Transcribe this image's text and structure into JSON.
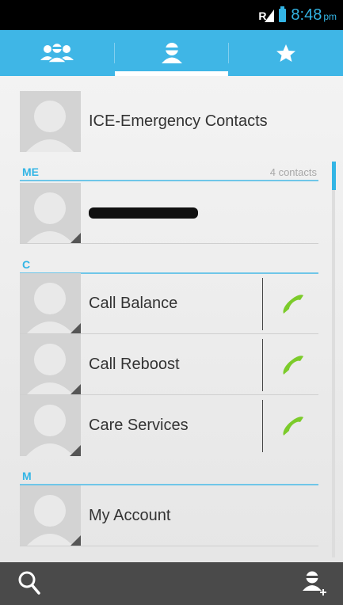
{
  "status_bar": {
    "time": "8:48",
    "ampm": "pm",
    "icons": [
      "signal-roaming-icon",
      "battery-icon"
    ]
  },
  "tabs": [
    {
      "name": "groups",
      "icon": "groups-icon",
      "active": false
    },
    {
      "name": "all-contacts",
      "icon": "person-icon",
      "active": true
    },
    {
      "name": "favorites",
      "icon": "star-icon",
      "active": false
    }
  ],
  "ice": {
    "label": "ICE-Emergency Contacts"
  },
  "sections": {
    "me": {
      "label": "ME",
      "count": "4 contacts"
    },
    "c": {
      "label": "C"
    },
    "m": {
      "label": "M"
    }
  },
  "contacts": [
    {
      "name": "Call Balance"
    },
    {
      "name": "Call Reboost"
    },
    {
      "name": "Care Services"
    },
    {
      "name": "My Account"
    }
  ],
  "colors": {
    "accent": "#33b5e5",
    "tab_bar": "#3fb6e6",
    "call_icon": "#7ccb2b",
    "bottom_bar": "#4a4a4a"
  },
  "bottom_bar": {
    "left_icon": "search-icon",
    "right_icon": "add-contact-icon"
  }
}
